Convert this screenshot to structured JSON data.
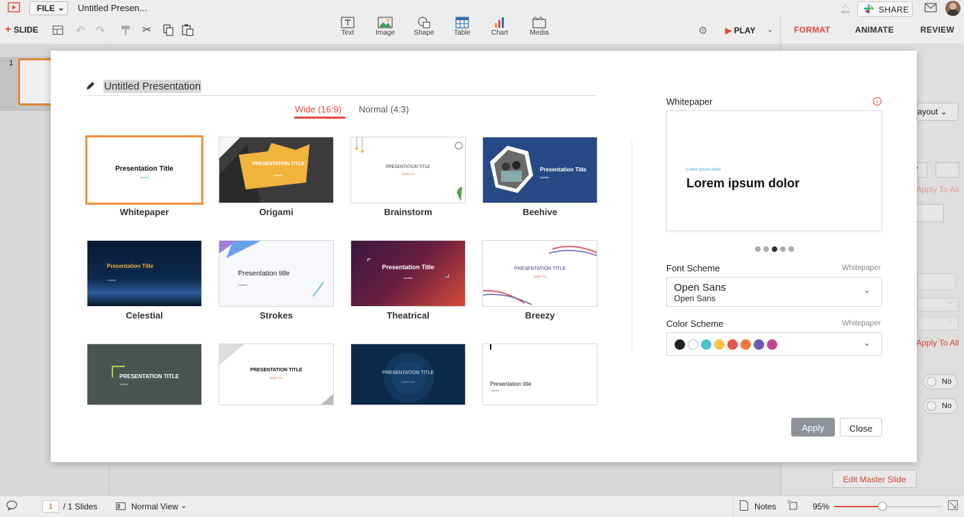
{
  "app": {
    "file_label": "FILE",
    "doc_title": "Untitled Presen...",
    "slide_label": "SLIDE",
    "share_label": "SHARE",
    "play_label": "PLAY"
  },
  "insert": [
    {
      "label": "Text",
      "icon": "text-icon"
    },
    {
      "label": "Image",
      "icon": "image-icon"
    },
    {
      "label": "Shape",
      "icon": "shape-icon"
    },
    {
      "label": "Table",
      "icon": "table-icon"
    },
    {
      "label": "Chart",
      "icon": "chart-icon"
    },
    {
      "label": "Media",
      "icon": "media-icon"
    }
  ],
  "right_tabs": [
    "FORMAT",
    "ANIMATE",
    "REVIEW"
  ],
  "right_panel": {
    "layout_label": "ayout",
    "apply_all_1": "Apply To All",
    "ics_label": "cs",
    "apply_all_2": "Apply To All",
    "toggle_1": "No",
    "toggle_2": "No",
    "edit_master": "Edit Master Slide"
  },
  "slides_panel": {
    "slide_number": "1"
  },
  "status": {
    "page": "1",
    "of_slides": "/ 1 Slides",
    "view": "Normal View",
    "notes": "Notes",
    "zoom": "95%",
    "zoom_fraction": 0.45
  },
  "modal": {
    "title": "Untitled Presentation",
    "ratio_tabs": [
      "Wide (16:9)",
      "Normal (4:3)"
    ],
    "templates": [
      {
        "name": "Whitepaper",
        "title": "Presentation Title",
        "subtitle": "Subtitle"
      },
      {
        "name": "Origami",
        "title": "PRESENTATION TITLE",
        "subtitle": "Subtitle"
      },
      {
        "name": "Brainstorm",
        "title": "PRESENTATION TITLE",
        "subtitle": "SUBTITLE"
      },
      {
        "name": "Beehive",
        "title": "Presentation Title",
        "subtitle": "Subtitle"
      },
      {
        "name": "Celestial",
        "title": "Presentation Title",
        "subtitle": "Subtitle"
      },
      {
        "name": "Strokes",
        "title": "Presentation title",
        "subtitle": "Subtitle"
      },
      {
        "name": "Theatrical",
        "title": "Presentation Title",
        "subtitle": "Subtitle"
      },
      {
        "name": "Breezy",
        "title": "PRESENTATION TITLE",
        "subtitle": "SUBTITLE"
      },
      {
        "name": "",
        "title": "PRESENTATION TITLE",
        "subtitle": "Subtitle"
      },
      {
        "name": "",
        "title": "PRESENTATION TITLE",
        "subtitle": "SUBTITLE"
      },
      {
        "name": "",
        "title": "PRESENTATION TITLE",
        "subtitle": "SUBTITLE"
      },
      {
        "name": "",
        "title": "Presentation title",
        "subtitle": "Subtitle"
      }
    ],
    "preview": {
      "label": "Whitepaper",
      "small_text": "Lorem ipsum dolor",
      "big_text": "Lorem ipsum dolor",
      "active_dot": 3
    },
    "font_scheme": {
      "label": "Font Scheme",
      "value_label": "Whitepaper",
      "heading_font": "Open Sans",
      "body_font": "Open Sans"
    },
    "color_scheme": {
      "label": "Color Scheme",
      "value_label": "Whitepaper",
      "colors": [
        "#222222",
        "#ffffff",
        "#4fc3c9",
        "#f6c244",
        "#e8534a",
        "#f07b3f",
        "#6a5bad",
        "#c2449a"
      ]
    },
    "apply_label": "Apply",
    "close_label": "Close"
  }
}
